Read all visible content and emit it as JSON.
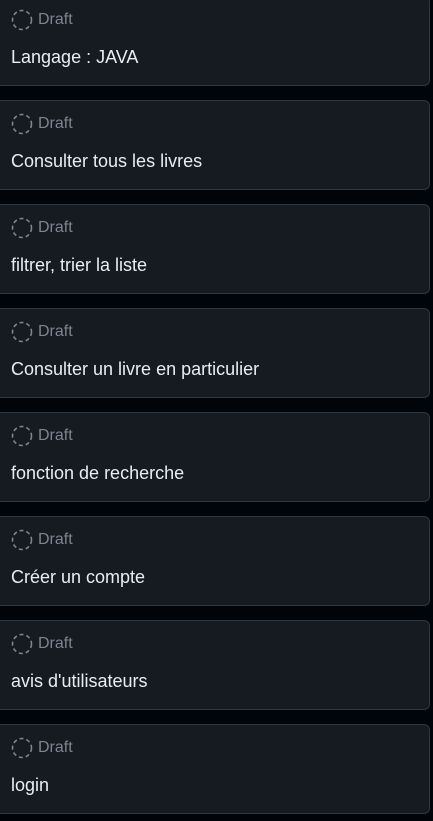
{
  "status_icon": "draft-dashed-circle-icon",
  "colors": {
    "background": "#010409",
    "card": "#161b22",
    "card_border": "#30363d",
    "status_text": "#7d8590",
    "title_text": "#e6edf3"
  },
  "cards": [
    {
      "status": "Draft",
      "title": "Langage : JAVA"
    },
    {
      "status": "Draft",
      "title": "Consulter tous les livres"
    },
    {
      "status": "Draft",
      "title": "filtrer, trier la liste"
    },
    {
      "status": "Draft",
      "title": "Consulter un livre en particulier"
    },
    {
      "status": "Draft",
      "title": "fonction de recherche"
    },
    {
      "status": "Draft",
      "title": "Créer un compte"
    },
    {
      "status": "Draft",
      "title": "avis d'utilisateurs"
    },
    {
      "status": "Draft",
      "title": "login"
    }
  ]
}
